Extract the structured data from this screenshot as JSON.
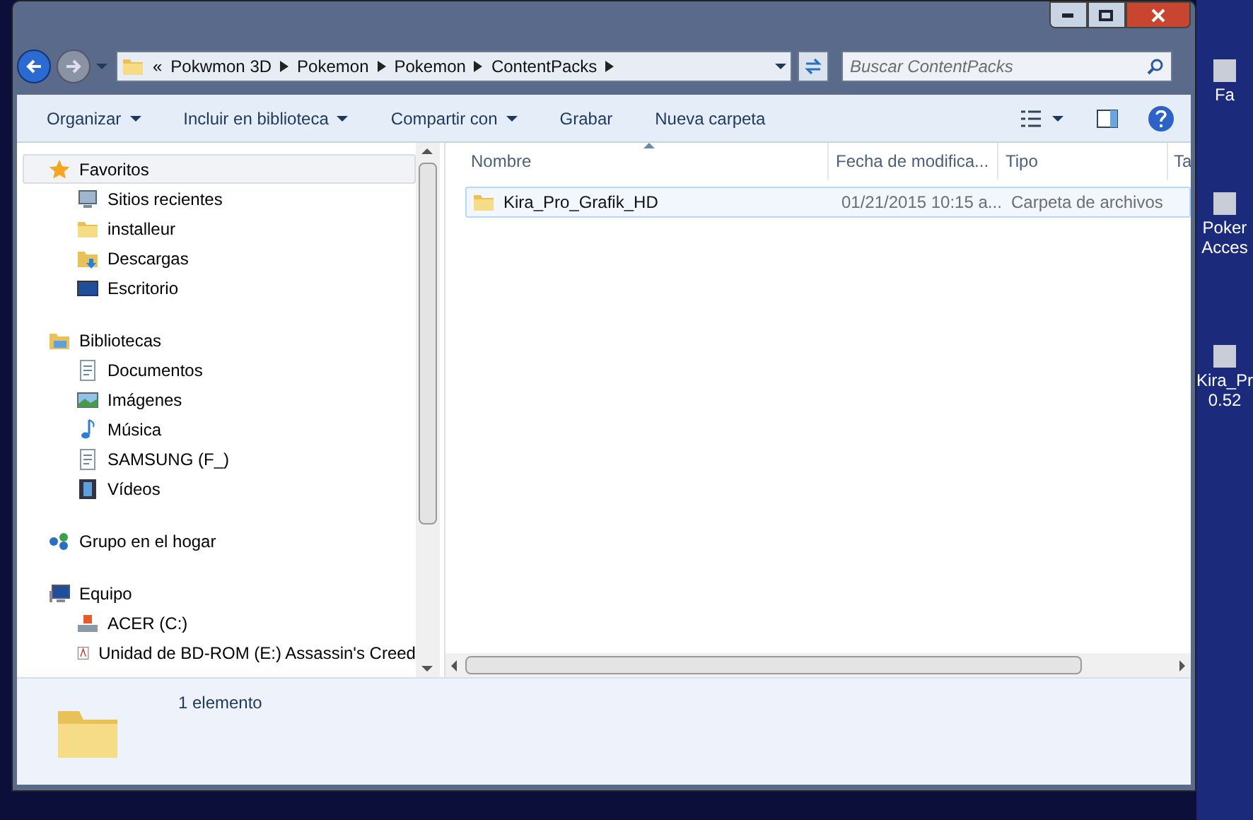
{
  "address": {
    "overflow": "«",
    "segments": [
      "Pokwmon 3D",
      "Pokemon",
      "Pokemon",
      "ContentPacks"
    ]
  },
  "search": {
    "placeholder": "Buscar ContentPacks"
  },
  "toolbar": [
    {
      "label": "Organizar",
      "dropdown": true
    },
    {
      "label": "Incluir en biblioteca",
      "dropdown": true
    },
    {
      "label": "Compartir con",
      "dropdown": true
    },
    {
      "label": "Grabar",
      "dropdown": false
    },
    {
      "label": "Nueva carpeta",
      "dropdown": false
    }
  ],
  "sidebar": {
    "groups": [
      {
        "label": "Favoritos",
        "kind": "star",
        "selected": true,
        "children": [
          {
            "label": "Sitios recientes",
            "kind": "recent"
          },
          {
            "label": "installeur",
            "kind": "folder"
          },
          {
            "label": "Descargas",
            "kind": "download"
          },
          {
            "label": "Escritorio",
            "kind": "desktop"
          }
        ]
      },
      {
        "label": "Bibliotecas",
        "kind": "library",
        "selected": false,
        "children": [
          {
            "label": "Documentos",
            "kind": "document"
          },
          {
            "label": "Imágenes",
            "kind": "image"
          },
          {
            "label": "Música",
            "kind": "music"
          },
          {
            "label": "SAMSUNG (F_)",
            "kind": "document"
          },
          {
            "label": "Vídeos",
            "kind": "video"
          }
        ]
      },
      {
        "label": "Grupo en el hogar",
        "kind": "homegroup",
        "selected": false
      },
      {
        "label": "Equipo",
        "kind": "computer",
        "selected": false,
        "children": [
          {
            "label": "ACER (C:)",
            "kind": "drive"
          },
          {
            "label": "Unidad de BD-ROM (E:) Assassin's Creed",
            "kind": "disc"
          }
        ]
      }
    ]
  },
  "table": {
    "columns": [
      {
        "label": "Nombre",
        "sorted": true
      },
      {
        "label": "Fecha de modifica...",
        "sorted": false
      },
      {
        "label": "Tipo",
        "sorted": false
      },
      {
        "label": "Ta",
        "sorted": false
      }
    ],
    "rows": [
      {
        "selected": true,
        "cells": [
          "Kira_Pro_Grafik_HD",
          "01/21/2015 10:15 a...",
          "Carpeta de archivos"
        ]
      }
    ]
  },
  "details": {
    "text": "1 elemento"
  },
  "desktop": {
    "icons": [
      {
        "lines": [
          "Fa"
        ]
      },
      {
        "lines": [
          "Poker",
          "Acces"
        ]
      },
      {
        "lines": [
          "Kira_Pr",
          "0.52"
        ]
      }
    ]
  }
}
